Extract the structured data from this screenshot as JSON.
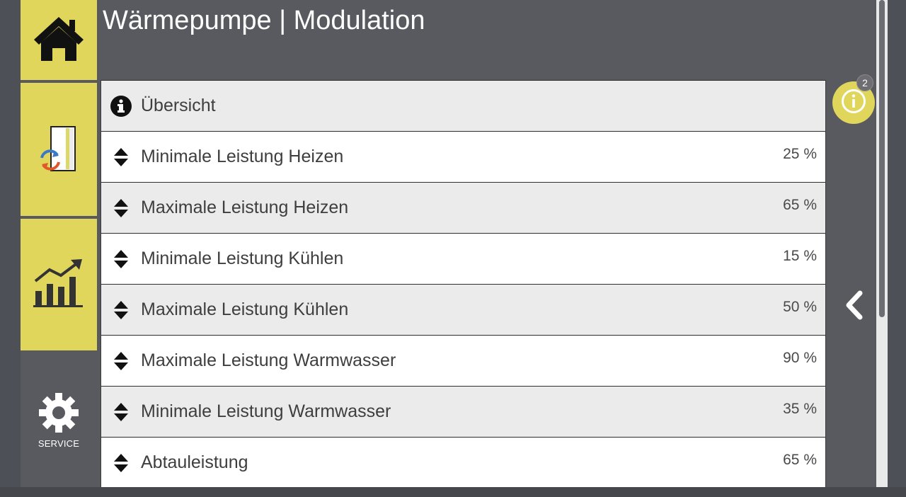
{
  "header": {
    "title": "Wärmepumpe | Modulation"
  },
  "sidebar": {
    "items": [
      {
        "name": "home",
        "icon": "home-icon"
      },
      {
        "name": "system",
        "icon": "heat-pump-unit-icon"
      },
      {
        "name": "statistics",
        "icon": "bar-chart-trend-icon"
      },
      {
        "name": "service",
        "icon": "gear-icon",
        "label": "SERVICE"
      }
    ]
  },
  "list": {
    "overview": {
      "label": "Übersicht",
      "icon": "info-circle-icon"
    },
    "rows": [
      {
        "label": "Minimale Leistung Heizen",
        "value": "25 %"
      },
      {
        "label": "Maximale Leistung Heizen",
        "value": "65 %"
      },
      {
        "label": "Minimale Leistung Kühlen",
        "value": "15 %"
      },
      {
        "label": "Maximale Leistung Kühlen",
        "value": "50 %"
      },
      {
        "label": "Maximale Leistung Warmwasser",
        "value": "90 %"
      },
      {
        "label": "Minimale Leistung Warmwasser",
        "value": "35 %"
      },
      {
        "label": "Abtauleistung",
        "value": "65 %"
      }
    ]
  },
  "notifications": {
    "count": "2",
    "icon": "info-icon"
  },
  "navigation": {
    "back_icon": "chevron-left-icon"
  },
  "colors": {
    "accent": "#e1d65c",
    "background": "#595a60",
    "row_grey": "#ebebeb",
    "row_white": "#ffffff"
  }
}
